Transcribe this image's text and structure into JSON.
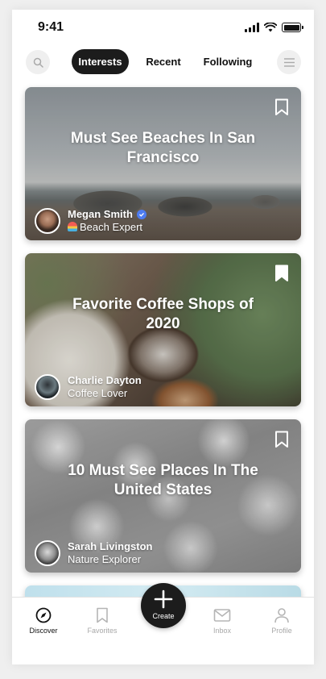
{
  "status_bar": {
    "time": "9:41"
  },
  "nav": {
    "tabs": [
      {
        "label": "Interests",
        "active": true
      },
      {
        "label": "Recent",
        "active": false
      },
      {
        "label": "Following",
        "active": false
      }
    ],
    "search_icon": "search-icon",
    "menu_icon": "menu-icon"
  },
  "cards": [
    {
      "title": "Must See Beaches In San Francisco",
      "author": "Megan Smith",
      "verified": true,
      "role": "Beach Expert"
    },
    {
      "title": "Favorite Coffee Shops of 2020",
      "author": "Charlie Dayton",
      "verified": false,
      "role": "Coffee Lover"
    },
    {
      "title": "10 Must See Places In The United States",
      "author": "Sarah Livingston",
      "verified": false,
      "role": "Nature Explorer"
    }
  ],
  "tab_bar": {
    "items": [
      {
        "label": "Discover",
        "icon": "compass-icon",
        "active": true
      },
      {
        "label": "Favorites",
        "icon": "bookmark-icon",
        "active": false
      },
      {
        "label": "Inbox",
        "icon": "mail-icon",
        "active": false
      },
      {
        "label": "Profile",
        "icon": "person-icon",
        "active": false
      }
    ],
    "create_label": "Create"
  },
  "colors": {
    "active_pill": "#1c1c1c",
    "verified": "#4d7cf0",
    "inactive_tab": "#a8a8a8"
  }
}
